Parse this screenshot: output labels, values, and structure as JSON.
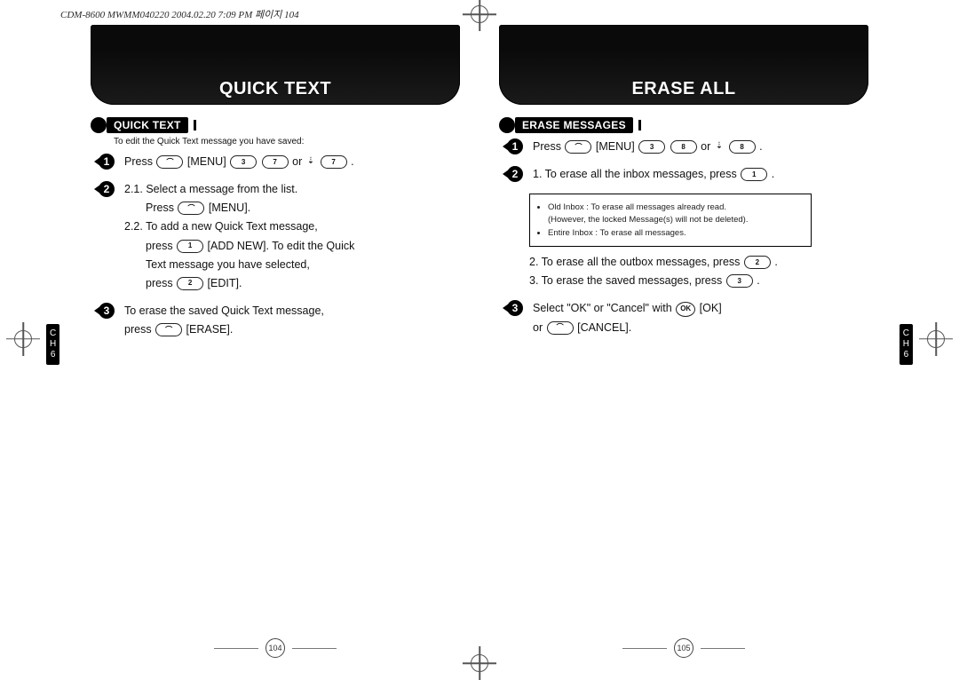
{
  "header": {
    "imprint": "CDM-8600 MWMM040220  2004.02.20 7:09 PM  페이지 104"
  },
  "left": {
    "banner": "QUICK TEXT",
    "section": "QUICK TEXT",
    "intro": "To edit the Quick Text message you have saved:",
    "steps": {
      "s1_a": "Press",
      "s1_b": "[MENU]",
      "s1_c": "or",
      "s1_d": ".",
      "s2_a": "2.1. Select a message from the list.",
      "s2_b": "Press",
      "s2_c": "[MENU].",
      "s2_d": "2.2. To add a new Quick Text message,",
      "s2_e": "press",
      "s2_f": "[ADD NEW]. To edit the Quick",
      "s2_g": "Text message you have selected,",
      "s2_h": "press",
      "s2_i": "[EDIT].",
      "s3_a": "To erase the saved Quick Text message,",
      "s3_b": "press",
      "s3_c": "[ERASE]."
    },
    "pagenum": "104",
    "keys": {
      "menu": "",
      "d3": "3",
      "d7": "7",
      "d2": "2",
      "d1": "1"
    }
  },
  "right": {
    "banner": "ERASE ALL",
    "section": "ERASE MESSAGES",
    "steps": {
      "s1_a": "Press",
      "s1_b": "[MENU]",
      "s1_c": "or",
      "s1_d": ".",
      "s2_a": "1. To erase all the inbox messages, press",
      "s2_a2": ".",
      "note1": "Old Inbox : To erase all messages already read.",
      "note2": "(However, the locked Message(s) will not be deleted).",
      "note3": "Entire Inbox : To erase all messages.",
      "s2_b": "2. To erase all the outbox messages, press",
      "s2_b2": ".",
      "s2_c": "3. To erase the saved messages, press",
      "s2_c2": ".",
      "s3_a": "Select \"OK\" or \"Cancel\" with",
      "s3_b": "[OK]",
      "s3_c": "or",
      "s3_d": "[CANCEL]."
    },
    "pagenum": "105",
    "keys": {
      "d3": "3",
      "d8": "8",
      "d1": "1",
      "d2": "2",
      "ok": "OK"
    }
  },
  "ch": {
    "c": "C",
    "h": "H",
    "n": "6"
  }
}
